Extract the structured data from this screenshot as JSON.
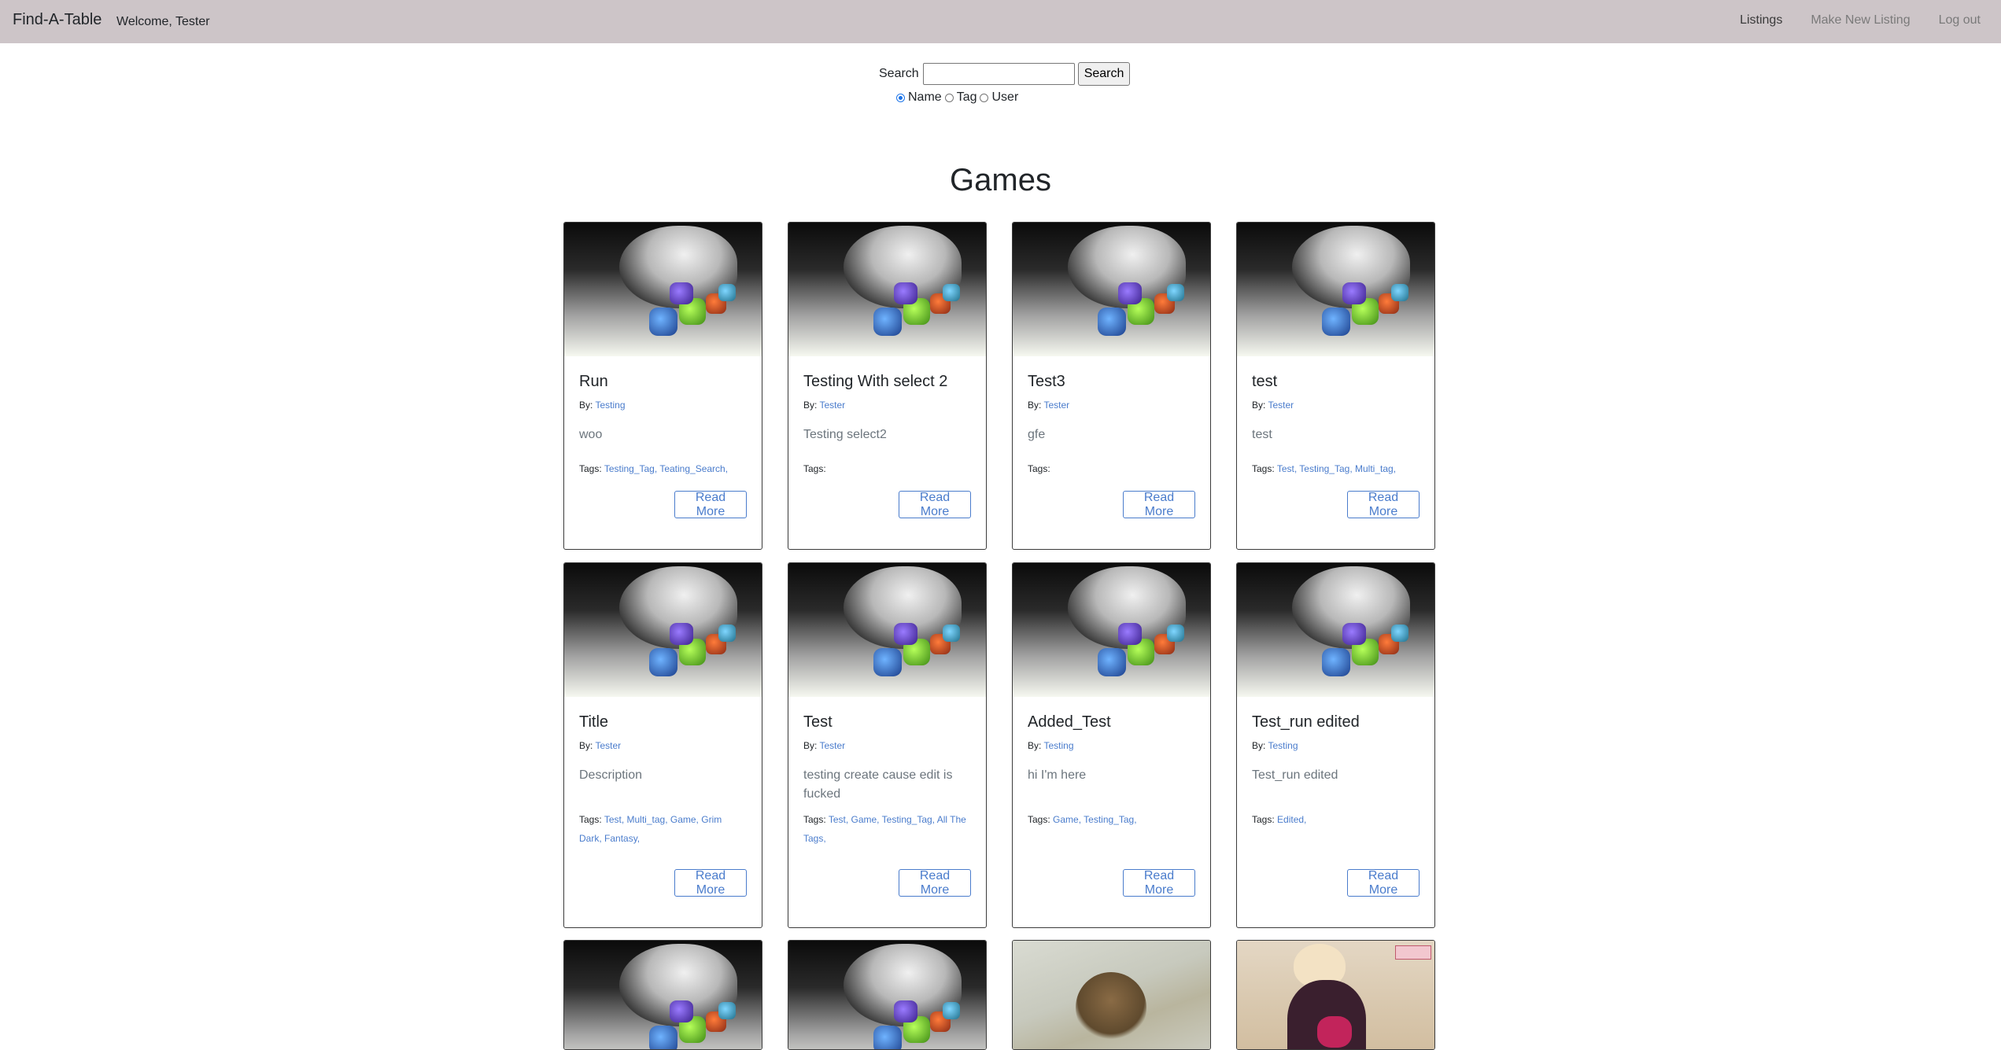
{
  "navbar": {
    "brand": "Find-A-Table",
    "welcome": "Welcome, Tester",
    "links": {
      "listings": "Listings",
      "new_listing": "Make New Listing",
      "logout": "Log out"
    }
  },
  "search": {
    "label": "Search",
    "value": "",
    "button": "Search",
    "options": [
      "Name",
      "Tag",
      "User"
    ],
    "selected": "Name"
  },
  "heading": "Games",
  "common": {
    "by_prefix": "By:",
    "tags_prefix": "Tags:",
    "read_more": "Read More"
  },
  "cards": [
    {
      "title": "Run",
      "author": "Testing",
      "description": "woo",
      "tags": [
        "Testing_Tag,",
        "Teating_Search,"
      ]
    },
    {
      "title": "Testing With select 2",
      "author": "Tester",
      "description": "Testing select2",
      "tags": []
    },
    {
      "title": "Test3",
      "author": "Tester",
      "description": "gfe",
      "tags": []
    },
    {
      "title": "test",
      "author": "Tester",
      "description": "test",
      "tags": [
        "Test,",
        "Testing_Tag,",
        "Multi_tag,"
      ]
    },
    {
      "title": "Title",
      "author": "Tester",
      "description": "Description",
      "tags": [
        "Test,",
        "Multi_tag,",
        "Game,",
        "Grim Dark,",
        "Fantasy,"
      ]
    },
    {
      "title": "Test",
      "author": "Tester",
      "description": "testing create cause edit is fucked",
      "tags": [
        "Test,",
        "Game,",
        "Testing_Tag,",
        "All The Tags,"
      ]
    },
    {
      "title": "Added_Test",
      "author": "Testing",
      "description": "hi I'm here",
      "tags": [
        "Game,",
        "Testing_Tag,"
      ]
    },
    {
      "title": "Test_run edited",
      "author": "Testing",
      "description": "Test_run edited",
      "tags": [
        "Edited,"
      ]
    }
  ]
}
